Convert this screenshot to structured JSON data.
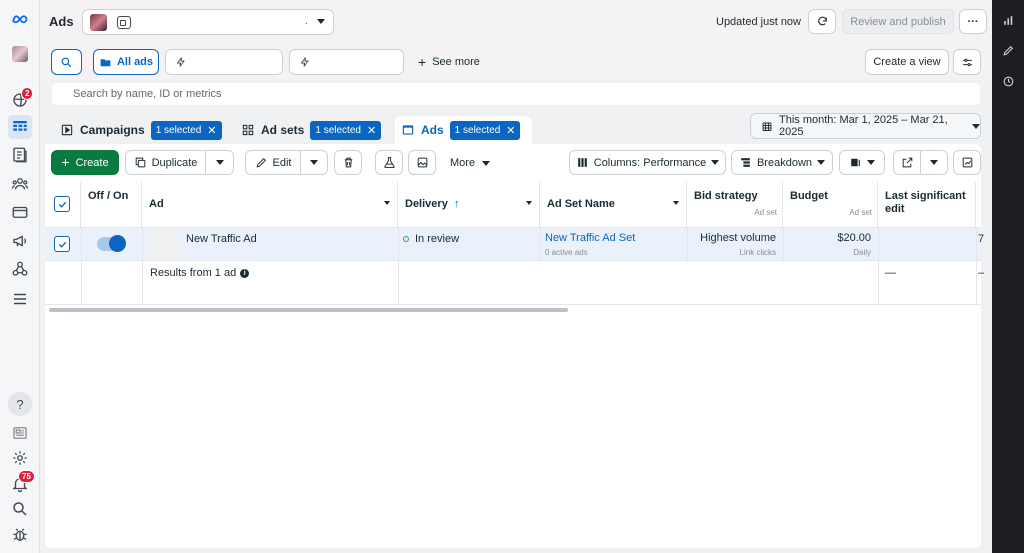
{
  "header": {
    "title": "Ads",
    "account_dot": ".",
    "updated": "Updated just now",
    "review_publish": "Review and publish",
    "more_dots": "···"
  },
  "nav_badges": {
    "activity": "2",
    "notifications": "75"
  },
  "filterbar": {
    "all_ads": "All ads",
    "see_more": "See more",
    "create_view": "Create a view"
  },
  "search": {
    "placeholder": "Search by name, ID or metrics"
  },
  "tabs": {
    "campaigns": {
      "label": "Campaigns",
      "badge": "1 selected"
    },
    "adsets": {
      "label": "Ad sets",
      "badge": "1 selected"
    },
    "ads": {
      "label": "Ads",
      "badge": "1 selected"
    },
    "close_x": "✕"
  },
  "daterange": "This month: Mar 1, 2025 – Mar 21, 2025",
  "toolbar": {
    "create": "Create",
    "duplicate": "Duplicate",
    "edit": "Edit",
    "more": "More",
    "columns": "Columns: Performance",
    "breakdown": "Breakdown"
  },
  "table": {
    "headers": {
      "offon": "Off / On",
      "ad": "Ad",
      "delivery": "Delivery",
      "delivery_sort": "↑",
      "adset_name": "Ad Set Name",
      "bid_strategy": "Bid strategy",
      "bid_strategy_sub": "Ad set",
      "budget": "Budget",
      "budget_sub": "Ad set",
      "last_edit": "Last significant edit"
    },
    "row": {
      "ad_name": "New Traffic Ad",
      "delivery": "In review",
      "adset_name": "New Traffic Ad Set",
      "adset_sub": "0 active ads",
      "bid": "Highest volume",
      "bid_sub": "Link clicks",
      "budget": "$20.00",
      "budget_sub": "Daily",
      "cut_col": "7"
    },
    "results": "Results from 1 ad",
    "results_last_edit": "—",
    "results_cut": "–"
  }
}
